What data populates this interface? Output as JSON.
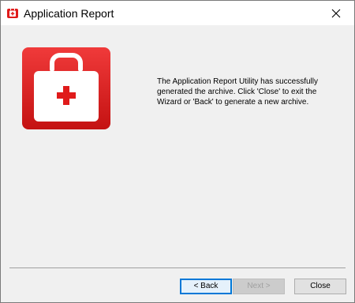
{
  "window": {
    "title": "Application Report",
    "close_glyph": "✕"
  },
  "icons": {
    "title_icon": "first-aid-kit-icon",
    "hero_icon": "first-aid-kit-icon",
    "close_icon": "close-icon"
  },
  "colors": {
    "kit_red": "#e01b1b",
    "kit_dark_red": "#b30f0f",
    "accent_blue": "#0078d7"
  },
  "main": {
    "message": "The Application Report Utility has successfully generated the archive. Click 'Close' to exit the Wizard or 'Back' to generate a new archive."
  },
  "footer": {
    "back_label": "< Back",
    "next_label": "Next >",
    "close_label": "Close"
  }
}
